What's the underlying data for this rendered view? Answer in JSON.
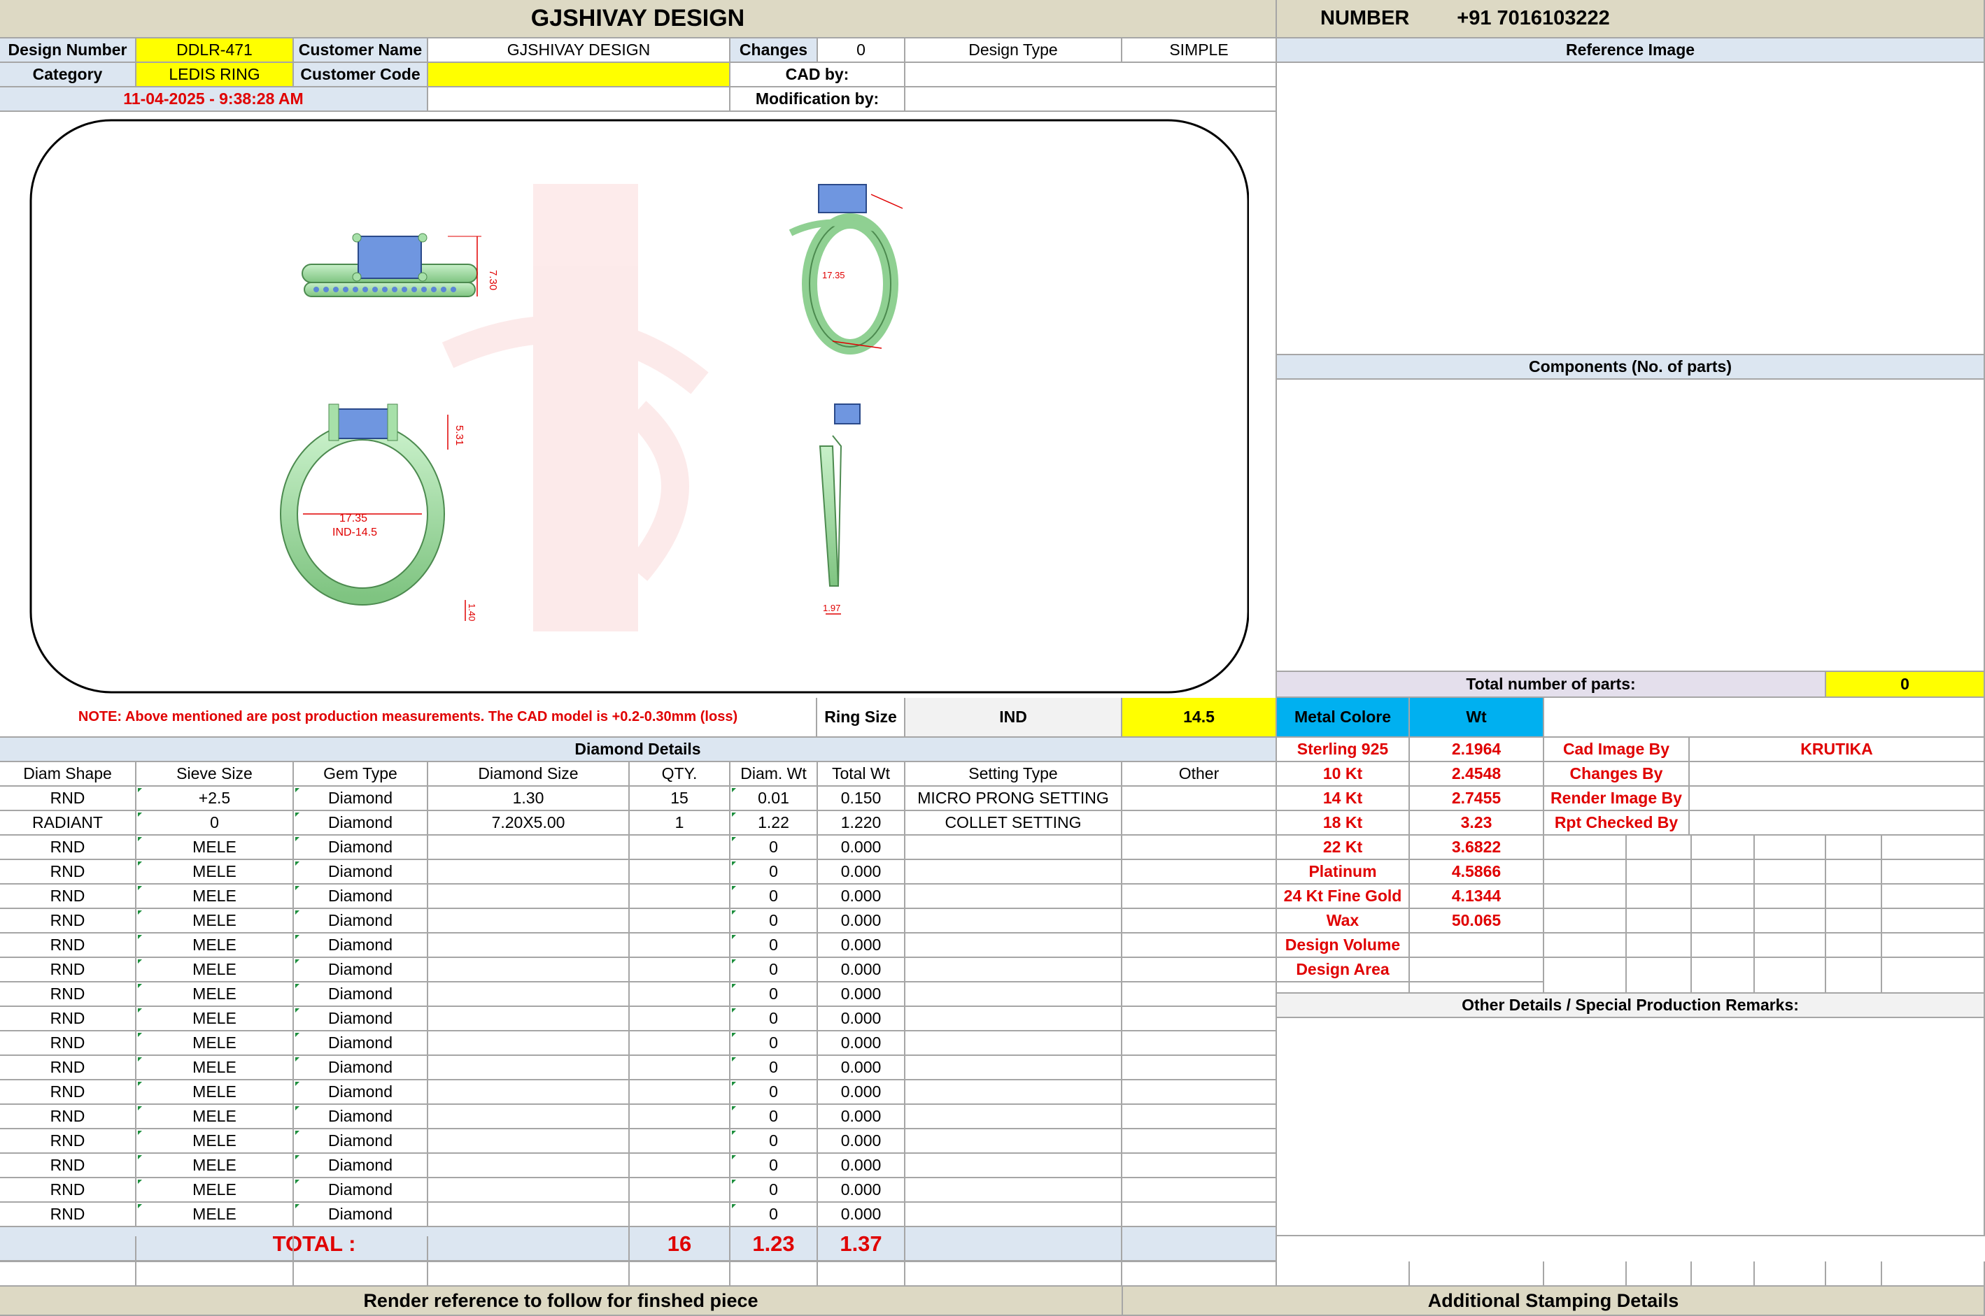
{
  "header": {
    "title": "GJSHIVAY DESIGN",
    "number_label": "NUMBER",
    "phone": "+91 7016103222"
  },
  "info": {
    "design_number_label": "Design Number",
    "design_number": "DDLR-471",
    "customer_name_label": "Customer Name",
    "customer_name": "GJSHIVAY DESIGN",
    "changes_label": "Changes",
    "changes": "0",
    "design_type_label": "Design Type",
    "design_type": "SIMPLE",
    "category_label": "Category",
    "category": "LEDIS RING",
    "customer_code_label": "Customer Code",
    "customer_code": "",
    "cad_by_label": "CAD by:",
    "cad_by": "",
    "date": "11-04-2025 - 9:38:28 AM",
    "modification_by_label": "Modification by:",
    "modification_by": ""
  },
  "drawing": {
    "dim_height": "7.30",
    "dim_top": "5.31",
    "dim_inner": "17.35",
    "ring_size_ind": "IND-14.5",
    "dim_band": "1.40",
    "dim_side": "1.97",
    "stone_color": "#6f96e0",
    "metal_color": "#a7e0a9",
    "dim_color": "#e00000"
  },
  "note": {
    "text": "NOTE: Above mentioned are post production measurements. The CAD model is +0.2-0.30mm (loss)",
    "ring_size_label": "Ring Size",
    "ring_size_system": "IND",
    "ring_size_value": "14.5"
  },
  "diamond": {
    "section_title": "Diamond Details",
    "columns": [
      "Diam Shape",
      "Sieve Size",
      "Gem Type",
      "Diamond Size",
      "QTY.",
      "Diam. Wt",
      "Total Wt",
      "Setting Type",
      "Other"
    ],
    "rows": [
      [
        "RND",
        "+2.5",
        "Diamond",
        "1.30",
        "15",
        "0.01",
        "0.150",
        "MICRO PRONG SETTING",
        ""
      ],
      [
        "RADIANT",
        "0",
        "Diamond",
        "7.20X5.00",
        "1",
        "1.22",
        "1.220",
        "COLLET SETTING",
        ""
      ],
      [
        "RND",
        "MELE",
        "Diamond",
        "",
        "",
        "0",
        "0.000",
        "",
        ""
      ],
      [
        "RND",
        "MELE",
        "Diamond",
        "",
        "",
        "0",
        "0.000",
        "",
        ""
      ],
      [
        "RND",
        "MELE",
        "Diamond",
        "",
        "",
        "0",
        "0.000",
        "",
        ""
      ],
      [
        "RND",
        "MELE",
        "Diamond",
        "",
        "",
        "0",
        "0.000",
        "",
        ""
      ],
      [
        "RND",
        "MELE",
        "Diamond",
        "",
        "",
        "0",
        "0.000",
        "",
        ""
      ],
      [
        "RND",
        "MELE",
        "Diamond",
        "",
        "",
        "0",
        "0.000",
        "",
        ""
      ],
      [
        "RND",
        "MELE",
        "Diamond",
        "",
        "",
        "0",
        "0.000",
        "",
        ""
      ],
      [
        "RND",
        "MELE",
        "Diamond",
        "",
        "",
        "0",
        "0.000",
        "",
        ""
      ],
      [
        "RND",
        "MELE",
        "Diamond",
        "",
        "",
        "0",
        "0.000",
        "",
        ""
      ],
      [
        "RND",
        "MELE",
        "Diamond",
        "",
        "",
        "0",
        "0.000",
        "",
        ""
      ],
      [
        "RND",
        "MELE",
        "Diamond",
        "",
        "",
        "0",
        "0.000",
        "",
        ""
      ],
      [
        "RND",
        "MELE",
        "Diamond",
        "",
        "",
        "0",
        "0.000",
        "",
        ""
      ],
      [
        "RND",
        "MELE",
        "Diamond",
        "",
        "",
        "0",
        "0.000",
        "",
        ""
      ],
      [
        "RND",
        "MELE",
        "Diamond",
        "",
        "",
        "0",
        "0.000",
        "",
        ""
      ],
      [
        "RND",
        "MELE",
        "Diamond",
        "",
        "",
        "0",
        "0.000",
        "",
        ""
      ],
      [
        "RND",
        "MELE",
        "Diamond",
        "",
        "",
        "0",
        "0.000",
        "",
        ""
      ]
    ],
    "total_label": "TOTAL :",
    "total_qty": "16",
    "total_diam_wt": "1.23",
    "total_wt": "1.37"
  },
  "reference": {
    "title": "Reference Image",
    "components_title": "Components (No. of parts)",
    "total_parts_label": "Total number of parts:",
    "total_parts": "0"
  },
  "metal": {
    "color_label": "Metal Colore",
    "wt_label": "Wt",
    "rows": [
      {
        "name": "Sterling 925",
        "wt": "2.1964"
      },
      {
        "name": "10 Kt",
        "wt": "2.4548"
      },
      {
        "name": "14 Kt",
        "wt": "2.7455"
      },
      {
        "name": "18 Kt",
        "wt": "3.23"
      },
      {
        "name": "22 Kt",
        "wt": "3.6822"
      },
      {
        "name": "Platinum",
        "wt": "4.5866"
      },
      {
        "name": "24 Kt Fine Gold",
        "wt": "4.1344"
      },
      {
        "name": "Wax",
        "wt": "50.065"
      },
      {
        "name": "Design Volume",
        "wt": ""
      },
      {
        "name": "Design Area",
        "wt": ""
      }
    ]
  },
  "credits": {
    "rows": [
      {
        "label": "Cad Image By",
        "value": "KRUTIKA"
      },
      {
        "label": "Changes By",
        "value": ""
      },
      {
        "label": "Render Image By",
        "value": ""
      },
      {
        "label": "Rpt Checked By",
        "value": ""
      }
    ]
  },
  "remarks": {
    "title": "Other Details / Special Production Remarks:"
  },
  "footer": {
    "render_ref": "Render reference to follow for finshed piece",
    "stamping": "Additional Stamping Details"
  }
}
